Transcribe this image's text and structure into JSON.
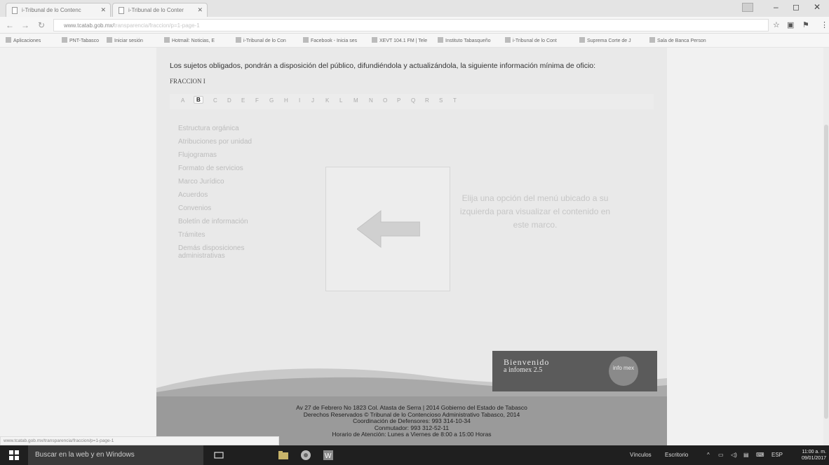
{
  "browser": {
    "tabs": [
      {
        "title": "i-Tribunal de lo Contenc"
      },
      {
        "title": "i-Tribunal de lo Conter"
      }
    ],
    "url": "www.tcatab.gob.mx/",
    "url_faint": "transparencia/fraccion/p=1-page-1",
    "bookmarks": [
      "Aplicaciones",
      "PNT-Tabasco",
      "Iniciar sesión",
      "Hotmail: Noticias, E",
      "i-Tribunal de lo Con",
      "Facebook - Inicia ses",
      "XEVT 104.1 FM | Tele",
      "Instituto Tabasqueño",
      "i-Tribunal de lo Cont",
      "Suprema Corte de J",
      "Sala de Banca Person"
    ]
  },
  "page": {
    "intro": "Los sujetos obligados, pondrán a disposición del público, difundiéndola y actualizándola, la siguiente información mínima de oficio:",
    "fraccion_label": "FRACCION I",
    "letters": [
      "A",
      "B",
      "C",
      "D",
      "E",
      "F",
      "G",
      "H",
      "I",
      "J",
      "K",
      "L",
      "M",
      "N",
      "O",
      "P",
      "Q",
      "R",
      "S",
      "T"
    ],
    "active_letter": "B",
    "menu": [
      "Estructura orgánica",
      "Atribuciones por unidad",
      "Flujogramas",
      "Formato de servicios",
      "Marco Jurídico",
      "Acuerdos",
      "Convenios",
      "Boletín de información",
      "Trámites",
      "Demás disposiciones administrativas"
    ],
    "select_message": "Elija una opción del menú ubicado a su izquierda para visualizar el contenido en este marco.",
    "banner": {
      "line1": "Bienvenido",
      "line2": "a infomex 2.5",
      "badge": "info mex"
    },
    "footer": [
      "Av 27 de Febrero No 1823 Col. Atasta de Serra | 2014 Gobierno del Estado de Tabasco",
      "Derechos Reservados © Tribunal de lo Contencioso Administrativo Tabasco, 2014",
      "Coordinación de Defensores: 993 314-10-34",
      "Conmutador: 993 312-52-11",
      "Horario de Atención: Lunes a Viernes de 8:00 a 15:00 Horas"
    ],
    "status_url": "www.tcatab.gob.mx/transparencia/fraccion/p=1-page-1"
  },
  "taskbar": {
    "search_placeholder": "Buscar en la web y en Windows",
    "links_label": "Vínculos",
    "desktop_label": "Escritorio",
    "language": "ESP",
    "time": "11:00 a. m.",
    "date": "09/01/2017"
  }
}
